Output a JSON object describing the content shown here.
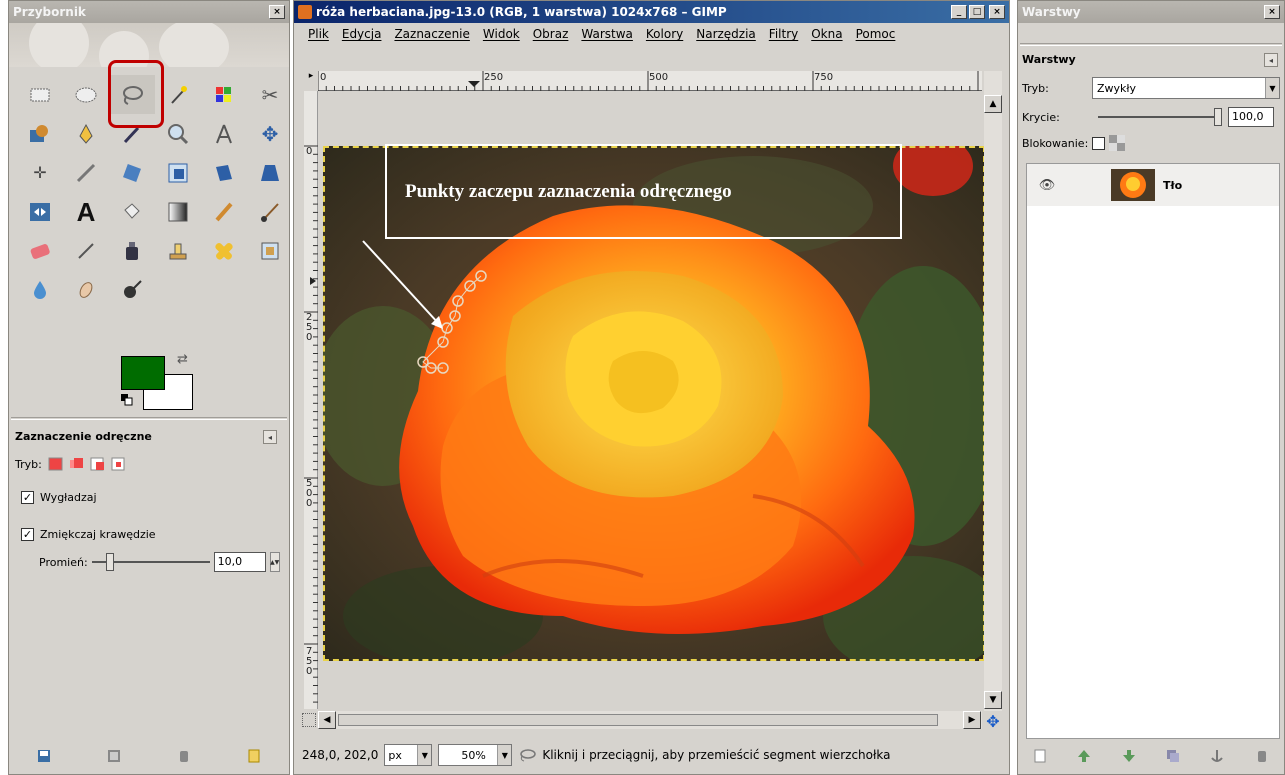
{
  "toolbox": {
    "title": "Przybornik",
    "close_label": "×",
    "options_title": "Zaznaczenie odręczne",
    "mode_label": "Tryb:",
    "antialias_label": "Wygładzaj",
    "feather_label": "Zmiękczaj krawędzie",
    "radius_label": "Promień:",
    "radius_value": "10,0",
    "check_mark": "✓",
    "fg_color": "#006c00",
    "bg_color": "#ffffff"
  },
  "image_window": {
    "title": "róża herbaciana.jpg-13.0 (RGB, 1 warstwa) 1024x768 – GIMP",
    "min_label": "_",
    "max_label": "□",
    "close_label": "×",
    "menu": [
      "Plik",
      "Edycja",
      "Zaznaczenie",
      "Widok",
      "Obraz",
      "Warstwa",
      "Kolory",
      "Narzędzia",
      "Filtry",
      "Okna",
      "Pomoc"
    ],
    "hruler_labels": [
      "0",
      "250",
      "500",
      "750"
    ],
    "vruler_labels": [
      "0",
      "2\n5\n0",
      "5\n0\n0",
      "7\n5\n0"
    ],
    "callout_text": "Punkty zaczepu zaznaczenia odręcznego",
    "coords": "248,0, 202,0",
    "unit": "px",
    "zoom": "50%",
    "status_message": "Kliknij i przeciągnij, aby przemieścić segment wierzchołka"
  },
  "layers_dialog": {
    "title": "Warstwy",
    "close_label": "×",
    "heading": "Warstwy",
    "mode_label": "Tryb:",
    "mode_value": "Zwykły",
    "opacity_label": "Krycie:",
    "opacity_value": "100,0",
    "lock_label": "Blokowanie:",
    "layer_name": "Tło"
  }
}
